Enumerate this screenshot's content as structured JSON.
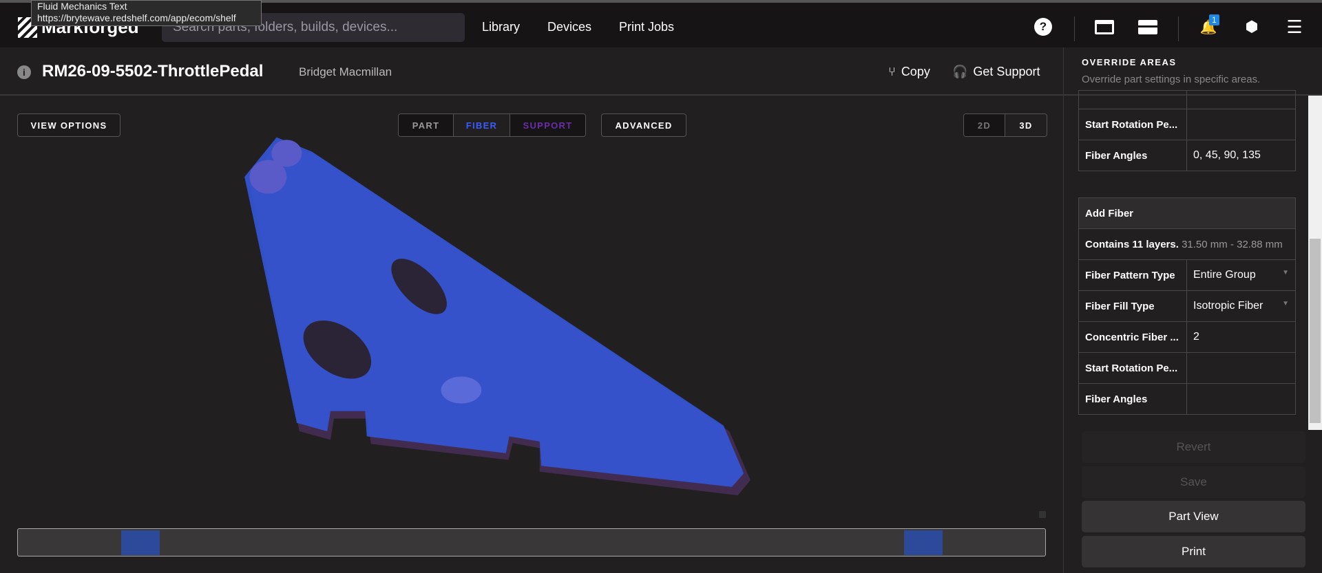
{
  "tooltip": {
    "title": "Fluid Mechanics Text",
    "url": "https://brytewave.redshelf.com/app/ecom/shelf"
  },
  "topbar": {
    "logo": "Markforged",
    "search_placeholder": "Search parts, folders, builds, devices...",
    "nav": [
      "Library",
      "Devices",
      "Print Jobs"
    ],
    "notification_count": "1"
  },
  "header": {
    "title": "RM26-09-5502-ThrottlePedal",
    "owner": "Bridget Macmillan",
    "copy": "Copy",
    "support": "Get Support"
  },
  "viewport": {
    "view_options": "VIEW OPTIONS",
    "modes": [
      "PART",
      "FIBER",
      "SUPPORT"
    ],
    "active_mode": "FIBER",
    "advanced": "ADVANCED",
    "dims": [
      "2D",
      "3D"
    ],
    "active_dim": "3D",
    "colors": {
      "fiber": "#3a5cff",
      "support": "#6a2fa8",
      "model": "#2f56d6"
    }
  },
  "panel": {
    "heading": "OVERRIDE AREAS",
    "subheading": "Override part settings in specific areas.",
    "table1": [
      {
        "label": "Start Rotation Pe...",
        "value": ""
      },
      {
        "label": "Fiber Angles",
        "value": "0, 45, 90, 135"
      }
    ],
    "table2": {
      "header": "Add Fiber",
      "layers": "Contains 11 layers.",
      "range": "31.50 mm - 32.88 mm",
      "rows": [
        {
          "label": "Fiber Pattern Type",
          "value": "Entire Group"
        },
        {
          "label": "Fiber Fill Type",
          "value": "Isotropic Fiber"
        },
        {
          "label": "Concentric Fiber ...",
          "value": "2"
        },
        {
          "label": "Start Rotation Pe...",
          "value": ""
        },
        {
          "label": "Fiber Angles",
          "value": ""
        }
      ]
    },
    "buttons": {
      "revert": "Revert",
      "save": "Save",
      "part_view": "Part View",
      "print": "Print"
    }
  }
}
